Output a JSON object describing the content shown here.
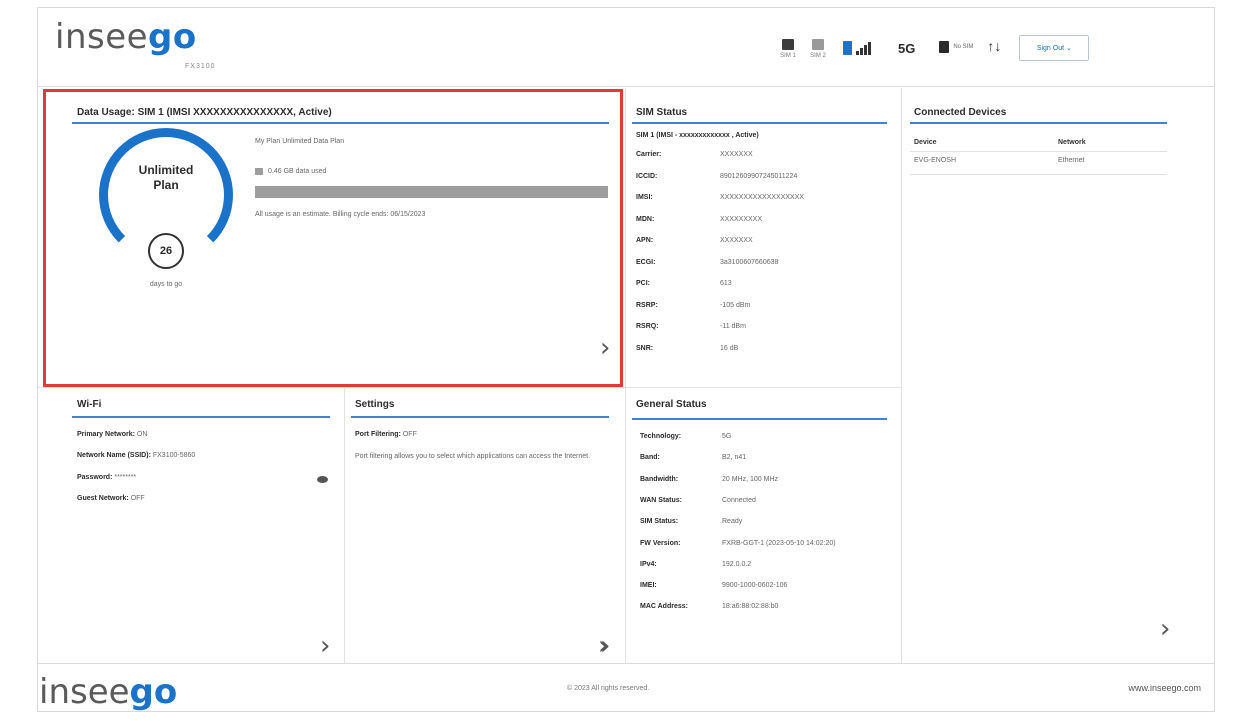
{
  "header": {
    "logo_text": "insee",
    "logo_accent": "go",
    "model": "FX3100",
    "sim_icons": [
      {
        "label": "SIM 1",
        "active": true,
        "icon": "sim-card-icon"
      },
      {
        "label": "SIM 2",
        "active": false,
        "icon": "sim-card-icon"
      }
    ],
    "connection_icon": "ethernet-signal-icon",
    "network_type": "5G",
    "sim_slot_text": "No SIM",
    "data_arrows": "↑↓",
    "sign_out_label": "Sign Out",
    "colors": {
      "accent": "#1a73c9",
      "highlight": "#e53935"
    }
  },
  "data_usage": {
    "title": "Data Usage:  SIM 1 (IMSI  XXXXXXXXXXXXXXX, Active)",
    "plan_name": "My Plan Unlimited Data Plan",
    "gauge_label_line1": "Unlimited",
    "gauge_label_line2": "Plan",
    "days_left": "26",
    "days_caption": "days to go",
    "used_text": "0.46 GB data used",
    "note": "All usage is an estimate. Billing cycle ends: 06/15/2023"
  },
  "sim_status": {
    "title": "SIM Status",
    "subtitle": "SIM 1 (IMSI -  xxxxxxxxxxxxx , Active)",
    "rows": [
      {
        "k": "Carrier:",
        "v": "XXXXXXX"
      },
      {
        "k": "ICCID:",
        "v": "89012609907245011224"
      },
      {
        "k": "IMSI:",
        "v": "XXXXXXXXXXXXXXXXXX"
      },
      {
        "k": "MDN:",
        "v": "XXXXXXXXX"
      },
      {
        "k": "APN:",
        "v": "XXXXXXX"
      },
      {
        "k": "ECGI:",
        "v": "3a3100607660638"
      },
      {
        "k": "PCI:",
        "v": "613"
      },
      {
        "k": "RSRP:",
        "v": "-105 dBm"
      },
      {
        "k": "RSRQ:",
        "v": "-11 dBm"
      },
      {
        "k": "SNR:",
        "v": "16 dB"
      }
    ]
  },
  "connected_devices": {
    "title": "Connected Devices",
    "columns": [
      "Device",
      "Network"
    ],
    "rows": [
      {
        "device": "EVG-ENOSH",
        "network": "Ethernet"
      }
    ]
  },
  "wifi": {
    "title": "Wi-Fi",
    "primary_label": "Primary Network:",
    "primary_value": "ON",
    "ssid_label": "Network Name (SSID):",
    "ssid_value": "FX3100-5860",
    "password_label": "Password:",
    "password_value": "********",
    "guest_label": "Guest Network:",
    "guest_value": "OFF"
  },
  "settings": {
    "title": "Settings",
    "port_label": "Port Filtering:",
    "port_value": "OFF",
    "description": "Port filtering allows you to select which applications can access the Internet."
  },
  "general_status": {
    "title": "General Status",
    "rows": [
      {
        "k": "Technology:",
        "v": "5G"
      },
      {
        "k": "Band:",
        "v": "B2, n41"
      },
      {
        "k": "Bandwidth:",
        "v": "20 MHz, 100 MHz"
      },
      {
        "k": "WAN Status:",
        "v": "Connected"
      },
      {
        "k": "SIM Status:",
        "v": "Ready"
      },
      {
        "k": "FW Version:",
        "v": "FXRB-GGT-1 (2023-05-10 14:02:20)"
      },
      {
        "k": "IPv4:",
        "v": "192.0.0.2"
      },
      {
        "k": "IMEI:",
        "v": "9900-1000-0602-106"
      },
      {
        "k": "MAC Address:",
        "v": "18:a6:88:02:88:b0"
      }
    ]
  },
  "footer": {
    "logo_text": "insee",
    "logo_accent": "go",
    "copyright": "© 2023 All rights reserved.",
    "site": "www.inseego.com"
  }
}
